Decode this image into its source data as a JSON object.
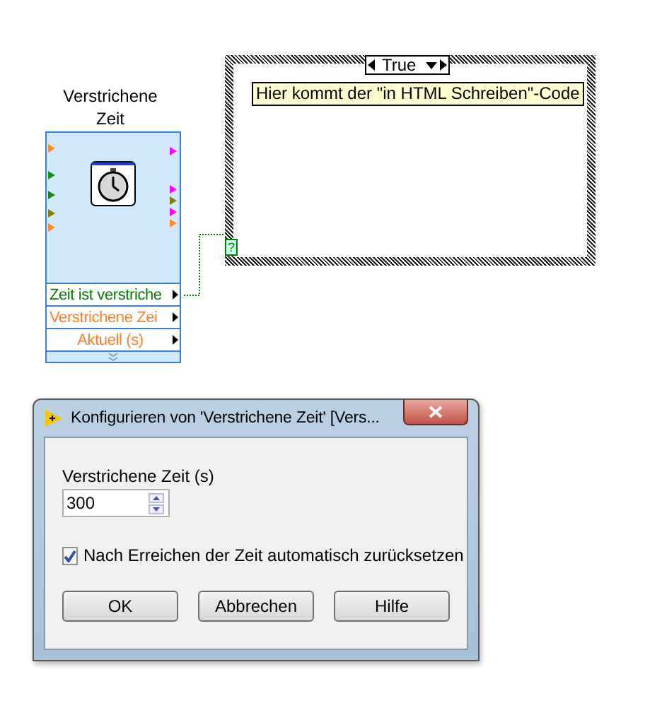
{
  "express_vi": {
    "label": "Verstrichene Zeit",
    "outputs": [
      {
        "text": "Zeit ist verstriche",
        "color": "#008000"
      },
      {
        "text": "Verstrichene Zei",
        "color": "#ff7f27"
      },
      {
        "text": "Aktuell (s)",
        "color": "#ff7f27"
      }
    ]
  },
  "case_structure": {
    "selector": "True",
    "comment": "Hier kommt der \"in HTML Schreiben\"-Code",
    "terminal": "?"
  },
  "dialog": {
    "title": "Konfigurieren von 'Verstrichene Zeit' [Vers...",
    "field_label": "Verstrichene Zeit (s)",
    "field_value": "300",
    "checkbox": {
      "label": "Nach Erreichen der Zeit automatisch zurücksetzen",
      "checked": true
    },
    "buttons": [
      "OK",
      "Abbrechen",
      "Hilfe"
    ]
  }
}
